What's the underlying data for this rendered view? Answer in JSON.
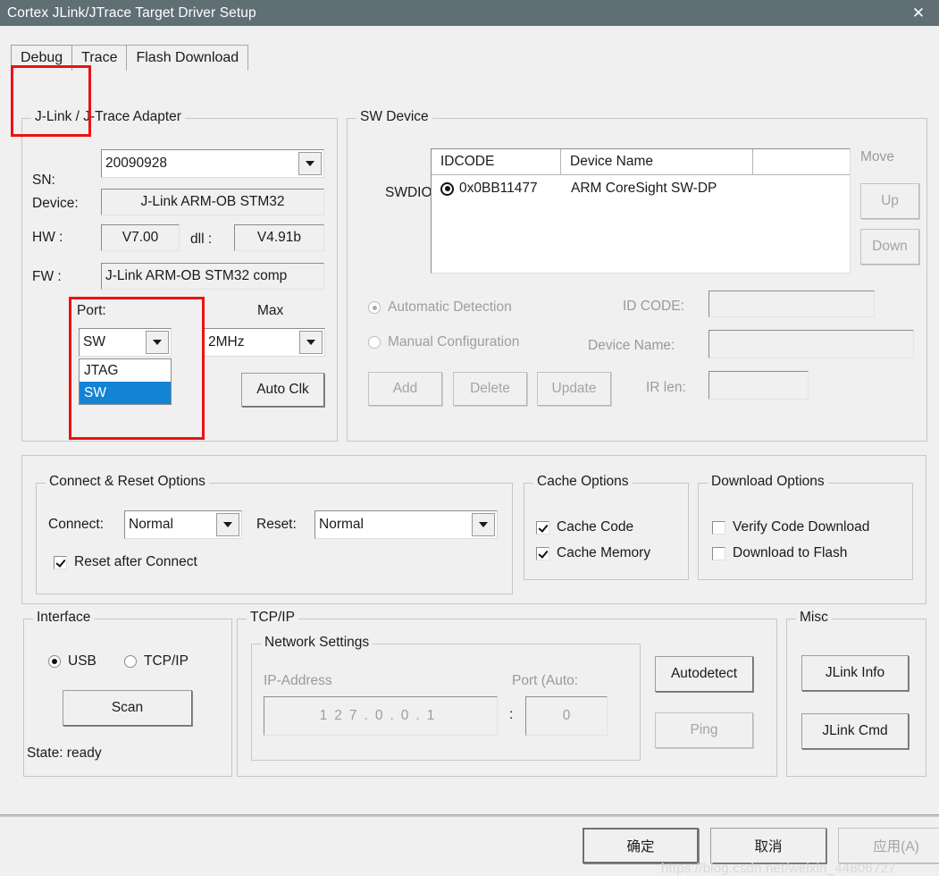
{
  "window": {
    "title": "Cortex JLink/JTrace Target Driver Setup",
    "close_icon": "close-icon",
    "titlebar_color": "#5f6f74"
  },
  "tabs": [
    {
      "label": "Debug",
      "selected": true
    },
    {
      "label": "Trace",
      "selected": false
    },
    {
      "label": "Flash Download",
      "selected": false
    }
  ],
  "jlink_adapter": {
    "legend": "J-Link / J-Trace Adapter",
    "sn_label": "SN:",
    "sn_value": "20090928",
    "device_label": "Device:",
    "device_value": "J-Link ARM-OB STM32",
    "hw_label": "HW :",
    "hw_value": "V7.00",
    "dll_label": "dll :",
    "dll_value": "V4.91b",
    "fw_label": "FW :",
    "fw_value": "J-Link ARM-OB STM32 comp",
    "port_label": "Port:",
    "port_value": "SW",
    "port_options": [
      "JTAG",
      "SW"
    ],
    "port_selected_option": "SW",
    "max_label": "Max",
    "max_value": "2MHz",
    "auto_clk_label": "Auto Clk"
  },
  "sw_device": {
    "legend": "SW Device",
    "swdio_label": "SWDIO",
    "columns": [
      "IDCODE",
      "Device Name",
      ""
    ],
    "rows": [
      {
        "idcode": "0x0BB11477",
        "device_name": "ARM CoreSight SW-DP",
        "extra": ""
      }
    ],
    "move_label": "Move",
    "up_label": "Up",
    "down_label": "Down",
    "automatic_detection_label": "Automatic Detection",
    "automatic_detection_selected": true,
    "manual_configuration_label": "Manual Configuration",
    "manual_configuration_selected": false,
    "id_code_label": "ID CODE:",
    "id_code_value": "",
    "device_name_label": "Device Name:",
    "device_name_value": "",
    "ir_len_label": "IR len:",
    "ir_len_value": "",
    "add_label": "Add",
    "delete_label": "Delete",
    "update_label": "Update"
  },
  "connect_reset": {
    "legend": "Connect & Reset Options",
    "connect_label": "Connect:",
    "connect_value": "Normal",
    "reset_label": "Reset:",
    "reset_value": "Normal",
    "reset_after_connect_label": "Reset after Connect",
    "reset_after_connect_checked": true
  },
  "cache_options": {
    "legend": "Cache Options",
    "items": [
      {
        "label": "Cache Code",
        "checked": true
      },
      {
        "label": "Cache Memory",
        "checked": true
      }
    ]
  },
  "download_options": {
    "legend": "Download Options",
    "items": [
      {
        "label": "Verify Code Download",
        "checked": false
      },
      {
        "label": "Download to Flash",
        "checked": false
      }
    ]
  },
  "interface": {
    "legend": "Interface",
    "usb_label": "USB",
    "usb_selected": true,
    "tcpip_label": "TCP/IP",
    "tcpip_selected": false,
    "scan_label": "Scan",
    "state_label": "State: ready"
  },
  "tcpip": {
    "legend": "TCP/IP",
    "network_settings_legend": "Network Settings",
    "ip_address_label": "IP-Address",
    "ip_octets": [
      "127",
      "0",
      "0",
      "1"
    ],
    "port_label": "Port (Auto:",
    "port_separator": ":",
    "port_value": "0",
    "autodetect_label": "Autodetect",
    "ping_label": "Ping"
  },
  "misc": {
    "legend": "Misc",
    "jlink_info_label": "JLink Info",
    "jlink_cmd_label": "JLink Cmd"
  },
  "footer": {
    "ok_label": "确定",
    "cancel_label": "取消",
    "apply_label": "应用(A)"
  },
  "watermark": "https://blog.csdn.net/weixin_44806727"
}
